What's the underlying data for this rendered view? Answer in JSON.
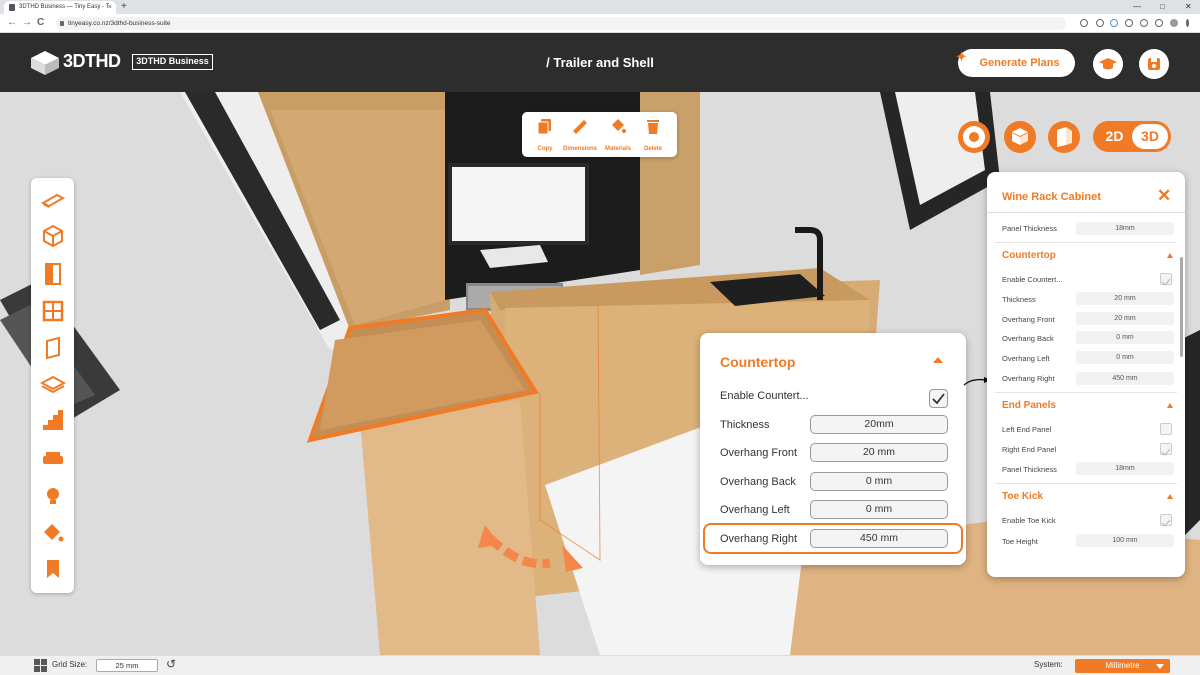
{
  "browser": {
    "tab_title": "3DTHD Business — Tiny Easy - T",
    "tab_close": "×",
    "new_tab": "+",
    "url": "tinyeasy.co.nz/3dthd-business-suite",
    "back": "←",
    "forward": "→",
    "reload": "C",
    "minimize": "—",
    "maximize": "□",
    "close": "✕"
  },
  "header": {
    "logo_text": "3DTHD",
    "badge": "3DTHD Business",
    "title": "/ Trailer and Shell",
    "generate_plans": "Generate Plans"
  },
  "quick_tools": [
    {
      "label": "Copy",
      "icon": "copy-icon"
    },
    {
      "label": "Dimensions",
      "icon": "ruler-icon"
    },
    {
      "label": "Materials",
      "icon": "paint-bucket-icon"
    },
    {
      "label": "Delete",
      "icon": "trash-icon"
    }
  ],
  "view_toggle": {
    "mode_2d": "2D",
    "mode_3d": "3D",
    "selected": "3D"
  },
  "popup": {
    "title": "Countertop",
    "enable_label": "Enable Countert...",
    "enable_checked": true,
    "rows": [
      {
        "label": "Thickness",
        "value": "20mm"
      },
      {
        "label": "Overhang Front",
        "value": "20 mm"
      },
      {
        "label": "Overhang Back",
        "value": "0 mm"
      },
      {
        "label": "Overhang Left",
        "value": "0 mm"
      },
      {
        "label": "Overhang Right",
        "value": "450 mm"
      }
    ]
  },
  "panel": {
    "title": "Wine Rack Cabinet",
    "close": "✕",
    "panel_thickness_label": "Panel Thickness",
    "panel_thickness_value": "18mm",
    "countertop": {
      "title": "Countertop",
      "enable_label": "Enable Countert...",
      "thickness_label": "Thickness",
      "thickness_value": "20 mm",
      "front_label": "Overhang Front",
      "front_value": "20 mm",
      "back_label": "Overhang Back",
      "back_value": "0 mm",
      "left_label": "Overhang Left",
      "left_value": "0 mm",
      "right_label": "Overhang Right",
      "right_value": "450 mm"
    },
    "end_panels": {
      "title": "End Panels",
      "left_label": "Left End Panel",
      "right_label": "Right End Panel",
      "thickness_label": "Panel Thickness",
      "thickness_value": "18mm"
    },
    "toe_kick": {
      "title": "Toe Kick",
      "enable_label": "Enable Toe Kick",
      "height_label": "Toe Height",
      "height_value": "100 mm"
    }
  },
  "bottom": {
    "grid_label": "Grid Size:",
    "grid_value": "25 mm",
    "reset": "↺",
    "system_label": "System:",
    "system_value": "Millimetre"
  },
  "colors": {
    "accent": "#f07a25",
    "header": "#2d2d2d"
  }
}
